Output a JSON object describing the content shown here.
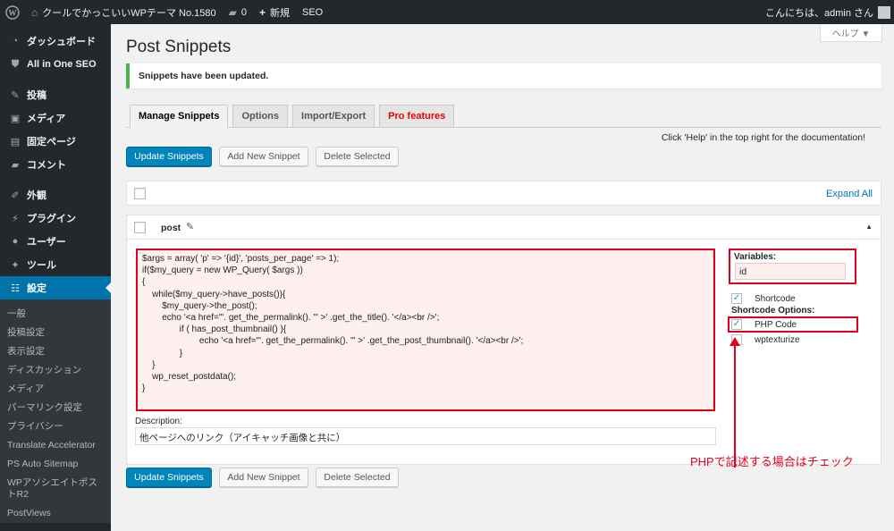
{
  "adminbar": {
    "site_name": "クールでかっこいいWPテーマ No.1580",
    "comments_count": "0",
    "new_label": "新規",
    "seo_label": "SEO",
    "greeting": "こんにちは、admin さん"
  },
  "sidebar": {
    "items": [
      {
        "label": "ダッシュボード",
        "icon": "dashboard-icon"
      },
      {
        "label": "All in One SEO",
        "icon": "shield-icon"
      },
      {
        "label": "投稿",
        "icon": "pin-icon"
      },
      {
        "label": "メディア",
        "icon": "media-icon"
      },
      {
        "label": "固定ページ",
        "icon": "page-icon"
      },
      {
        "label": "コメント",
        "icon": "comment-icon"
      },
      {
        "label": "外観",
        "icon": "brush-icon"
      },
      {
        "label": "プラグイン",
        "icon": "plugin-icon"
      },
      {
        "label": "ユーザー",
        "icon": "user-icon"
      },
      {
        "label": "ツール",
        "icon": "wrench-icon"
      },
      {
        "label": "設定",
        "icon": "settings-icon"
      }
    ],
    "submenu": [
      "一般",
      "投稿設定",
      "表示設定",
      "ディスカッション",
      "メディア",
      "パーマリンク設定",
      "プライバシー",
      "Translate Accelerator",
      "PS Auto Sitemap",
      "WPアソシエイトポストR2",
      "PostViews"
    ]
  },
  "help_tab": "ヘルプ ▼",
  "page_title": "Post Snippets",
  "notice": "Snippets have been updated.",
  "tabs": [
    "Manage Snippets",
    "Options",
    "Import/Export",
    "Pro features"
  ],
  "help_note": "Click 'Help' in the top right for the documentation!",
  "buttons": {
    "update": "Update Snippets",
    "add_new": "Add New Snippet",
    "delete": "Delete Selected"
  },
  "expand_all": "Expand All",
  "snippet": {
    "name": "post",
    "code": "$args = array( 'p' => '{id}', 'posts_per_page' => 1);\nif($my_query = new WP_Query( $args ))\n{\n    while($my_query->have_posts()){\n        $my_query->the_post();\n        echo '<a href=\"'. get_the_permalink(). '\" >' .get_the_title(). '</a><br />';\n               if ( has_post_thumbnail() ){\n                       echo '<a href=\"'. get_the_permalink(). '\" >' .get_the_post_thumbnail(). '</a><br />';\n               }\n    }\n    wp_reset_postdata();\n}",
    "variables_label": "Variables:",
    "variables_value": "id",
    "shortcode_label": "Shortcode",
    "shortcode_options_label": "Shortcode Options:",
    "php_code_label": "PHP Code",
    "wptexturize_label": "wptexturize",
    "description_label": "Description:",
    "description_value": "他ページへのリンク（アイキャッチ画像と共に）"
  },
  "annotation": "PHPで記述する場合はチェック",
  "colors": {
    "admin_bar": "#23282d",
    "primary": "#0085ba",
    "highlight": "#e2001a",
    "notice_success": "#46b450"
  }
}
